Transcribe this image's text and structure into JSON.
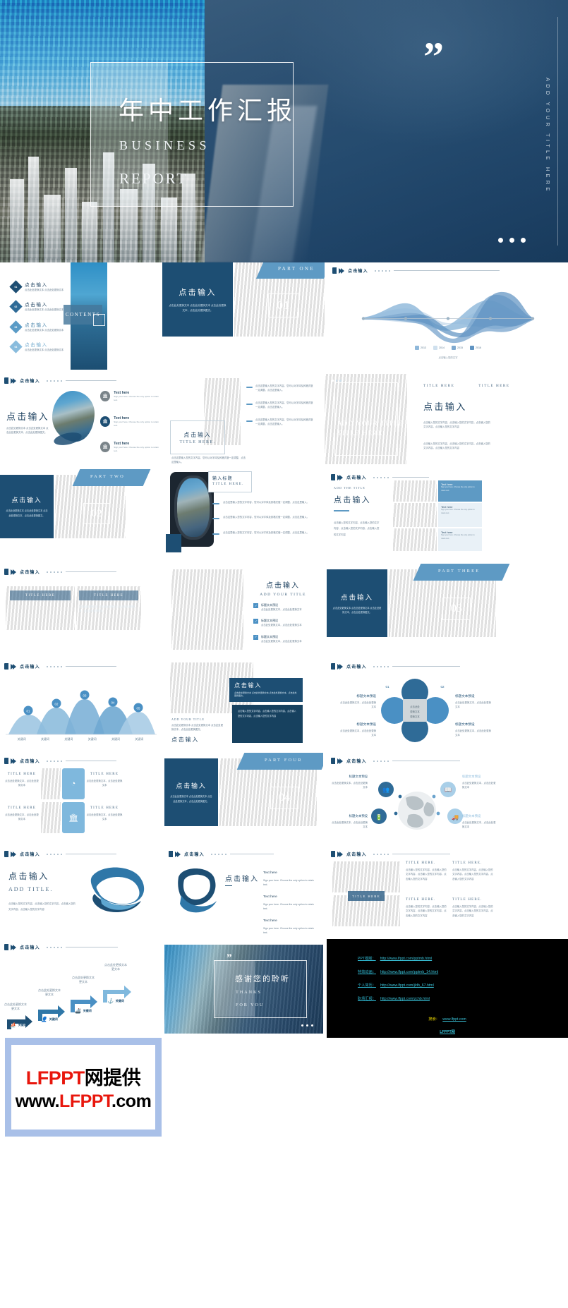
{
  "hero": {
    "title_cn": "年中工作汇报",
    "subtitle_en1": "BUSINESS",
    "subtitle_en2": "REPORT",
    "vertical_text": "ADD YOUR TITLE HERE",
    "quote_mark": "”",
    "accent": "#1d4e73"
  },
  "common": {
    "header_label": "点击输入",
    "click_input": "点击输入",
    "title_here": "TITLE HERE.",
    "title_here_plain": "TITLE HERE",
    "text_here": "Text here",
    "add_your_title": "ADD YOUR TITLE",
    "add_the_title": "ADD THE TITLE",
    "keyword": "关键词",
    "body_cn": "点击此处更换文本 点击此处更换文本 点击此处更换文本，点击此处更换图文。",
    "body_cn_long": "点击输入您的文字内容，点击输入您的文字内容，点击输入您的文字内容，点击输入您的文字内容",
    "body_cn_mid": "点击这里输入您的文字内容，您可以对字体及其格式做一定调整，点击这里输入。",
    "body_en": "Sign your here. Choose the only option to retain text.",
    "label_text": "标题文本预设",
    "label_body": "点击此处更换文本，点击此处更换文本"
  },
  "contents": {
    "label": "CONTENTS",
    "items": [
      {
        "num": "01",
        "title": "点击输入",
        "desc": "点击此处更换文本 点击此处更换文本"
      },
      {
        "num": "02",
        "title": "点击输入",
        "desc": "点击此处更换文本 点击此处更换文本"
      },
      {
        "num": "03",
        "title": "点击输入",
        "desc": "点击此处更换文本 点击此处更换文本"
      },
      {
        "num": "04",
        "title": "点击输入",
        "desc": "点击此处更换文本 点击此处更换文本"
      }
    ]
  },
  "sections": [
    {
      "label": "PART ONE",
      "number": "01"
    },
    {
      "label": "PART TWO",
      "number": "02"
    },
    {
      "label": "PART THREE",
      "number": "03"
    },
    {
      "label": "PART FOUR",
      "number": "04"
    }
  ],
  "chart_data": {
    "type": "area",
    "title": "点击输入",
    "caption": "点击输入您的文字",
    "categories": [
      "2013",
      "2014",
      "2015",
      "2016"
    ],
    "x": [
      0,
      1,
      2,
      3,
      4,
      5
    ],
    "series": [
      {
        "name": "2013",
        "color": "#8fb8da",
        "values": [
          8,
          22,
          30,
          18,
          26,
          10
        ]
      },
      {
        "name": "2014",
        "color": "#cfe0ee",
        "values": [
          6,
          16,
          40,
          24,
          14,
          8
        ]
      },
      {
        "name": "2015",
        "color": "#7fa9cf",
        "values": [
          10,
          14,
          22,
          52,
          30,
          12
        ]
      },
      {
        "name": "2016",
        "color": "#5f93c2",
        "values": [
          12,
          18,
          26,
          36,
          58,
          14
        ]
      }
    ],
    "legend_position": "bottom",
    "grid": false,
    "xlabel": "",
    "ylabel": ""
  },
  "thanks": {
    "title_cn": "感谢您的聆听",
    "line1": "THANKS",
    "line2": "FOR YOU",
    "quote_mark": "”"
  },
  "links_slide": {
    "rows": [
      {
        "label": "PPT模版：",
        "url": "http://www.lfppt.com/pptmb.html"
      },
      {
        "label": "特效动画：",
        "url": "http://www.lfppt.com/pptmb_14.html"
      },
      {
        "label": "个人简历：",
        "url": "http://www.lfppt.com/jldb_67.html"
      },
      {
        "label": "职场汇报：",
        "url": "http://www.lfppt.com/zchb.html"
      }
    ],
    "search_label": "搜索：",
    "search_url": "www.lfppt.com",
    "search_name": "LFPPT网"
  },
  "footer": {
    "line1_red": "LFPPT",
    "line1_rest": "网提供",
    "line2_a": "www.",
    "line2_red": "LFPPT",
    "line2_b": ".com"
  },
  "icons": {
    "bank": "bank-icon",
    "clock": "clock-icon",
    "people": "people-icon",
    "book": "book-icon",
    "truck": "truck-icon",
    "battery": "battery-icon",
    "globe": "globe-icon",
    "anchor": "anchor-icon",
    "boat": "boat-icon",
    "user": "user-icon",
    "check": "check-icon",
    "image": "image-icon"
  }
}
